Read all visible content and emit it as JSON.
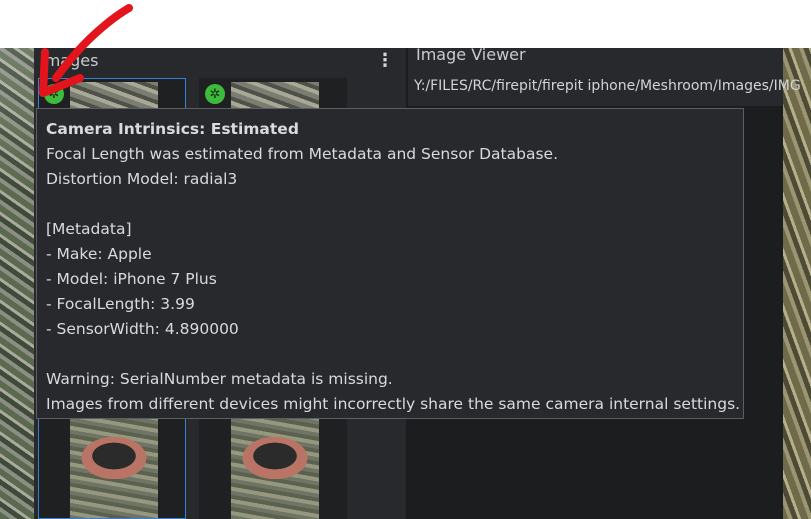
{
  "images_panel": {
    "title": "Images",
    "menu_glyph": "⋮"
  },
  "image_viewer": {
    "title": "Image Viewer",
    "path": "Y:/FILES/RC/firepit/firepit iphone/Meshroom/Images/IMG"
  },
  "thumbnails": {
    "status_icon": "camera-shutter-icon",
    "status_color": "#3dbb3d",
    "selected_border_color": "#3a7fd2"
  },
  "tooltip": {
    "title": "Camera Intrinsics: Estimated",
    "lines": [
      "Focal Length was estimated from Metadata and Sensor Database.",
      "Distortion Model: radial3",
      "",
      "[Metadata]",
      "- Make: Apple",
      "- Model: iPhone 7 Plus",
      "- FocalLength: 3.99",
      "- SensorWidth: 4.890000",
      "",
      "Warning: SerialNumber metadata is missing.",
      "Images from different devices might incorrectly share the same camera internal settings."
    ]
  },
  "annotation": {
    "arrow_color": "#e3141b"
  }
}
